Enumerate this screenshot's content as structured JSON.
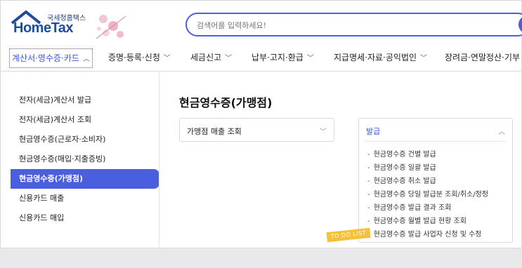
{
  "header": {
    "logo_small": "국세청홈택스",
    "logo_big": "HomeTax",
    "search_placeholder": "검색어를 입력하세요!"
  },
  "nav": {
    "items": [
      {
        "label": "계산서·영수증·카드",
        "active": true
      },
      {
        "label": "증명·등록·신청"
      },
      {
        "label": "세금신고"
      },
      {
        "label": "납부·고지·환급"
      },
      {
        "label": "지급명세·자료·공익법인"
      },
      {
        "label": "장려금·연말정산·기부"
      }
    ]
  },
  "sidebar": {
    "items": [
      {
        "label": "전자(세금)계산서 발급"
      },
      {
        "label": "전자(세금)계산서 조회"
      },
      {
        "label": "현금영수증(근로자·소비자)"
      },
      {
        "label": "현금영수증(매입·지출증빙)"
      },
      {
        "label": "현금영수증(가맹점)",
        "active": true
      },
      {
        "label": "신용카드 매출"
      },
      {
        "label": "신용카드 매입"
      }
    ]
  },
  "main": {
    "title": "현금영수증(가맹점)",
    "dropdown_label": "가맹점 매출 조회",
    "panel": {
      "header": "발급",
      "items": [
        "현금영수증 건별 발급",
        "현금영수증 일괄 발급",
        "현금영수증 취소 발급",
        "현금영수증 당일 발급분 조회/취소/정정",
        "현금영수증 발급 결과 조회",
        "현금영수증 월별 발급 현황 조회",
        "현금영수증 발급 사업자 신청 및 수정"
      ]
    },
    "sticker": "TO DO LIST"
  },
  "colors": {
    "accent": "#4a5ee0",
    "nav_active": "#3b57d8",
    "sticker": "#f6c13a"
  }
}
